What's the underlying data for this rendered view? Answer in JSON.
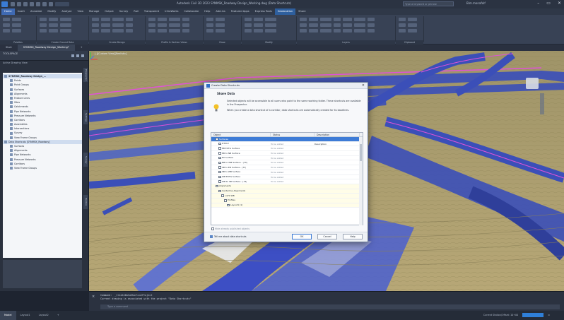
{
  "window": {
    "title": "Autodesk Civil 3D 2023  SYNMSK_Roadway Design_Working.dwg (Data Shortcuts)",
    "search_placeholder": "Type a keyword or phrase",
    "user": "Bim.monafolf",
    "controls": [
      "–",
      "▭",
      "✕"
    ]
  },
  "ribbon": {
    "tabs": [
      "Home",
      "Insert",
      "Annotate",
      "Modify",
      "Analyze",
      "View",
      "Manage",
      "Output",
      "Survey",
      "Rail",
      "Transparent",
      "InfraWorks",
      "Collaborate",
      "Help",
      "Add-ins",
      "Featured Apps",
      "Express Tools",
      "Geolocation",
      "Share"
    ],
    "active_tab": "Home",
    "panel_labels": [
      "Palettes",
      "Create Ground Data",
      "Create Design",
      "Profile & Section Views",
      "Draw",
      "Modify",
      "Layers",
      "Clipboard"
    ]
  },
  "file_tabs": [
    "Start",
    "SYNMSK_Roadway Design_Working*",
    "+"
  ],
  "toolspace": {
    "title": "TOOLSPACE",
    "subheader": "Active Drawing View",
    "tree": [
      {
        "label": "SYNMSK_Roadway Design_...",
        "bold": true,
        "sel": true,
        "indent": 0
      },
      {
        "label": "Points",
        "indent": 2
      },
      {
        "label": "Point Groups",
        "indent": 2
      },
      {
        "label": "Surfaces",
        "indent": 2
      },
      {
        "label": "Alignments",
        "indent": 2
      },
      {
        "label": "Feature Lines",
        "indent": 2
      },
      {
        "label": "Sites",
        "indent": 2
      },
      {
        "label": "Catchments",
        "indent": 2
      },
      {
        "label": "Pipe Networks",
        "indent": 2
      },
      {
        "label": "Pressure Networks",
        "indent": 2
      },
      {
        "label": "Corridors",
        "indent": 2
      },
      {
        "label": "Assemblies",
        "indent": 2
      },
      {
        "label": "Intersections",
        "indent": 2
      },
      {
        "label": "Survey",
        "indent": 2
      },
      {
        "label": "View Frame Groups",
        "indent": 2
      },
      {
        "label": "Data Shortcuts [SYNMSK_Roadway]",
        "indent": 0,
        "sel": true
      },
      {
        "label": "Surfaces",
        "indent": 2
      },
      {
        "label": "Alignments",
        "indent": 2
      },
      {
        "label": "Pipe Networks",
        "indent": 2
      },
      {
        "label": "Pressure Networks",
        "indent": 2
      },
      {
        "label": "Corridors",
        "indent": 2
      },
      {
        "label": "View Frame Groups",
        "indent": 2
      }
    ],
    "side_tabs": [
      "Prospector",
      "Settings",
      "Survey",
      "Toolbox"
    ]
  },
  "viewport": {
    "label": "[-][Custom View][Realistic]"
  },
  "dialog": {
    "title": "Create Data Shortcuts",
    "heading": "Share Data",
    "desc1": "Selected objects will be accessible to all users who point to the same working folder. These shortcuts are available in the Prospector.",
    "desc2": "When you create a data shortcut of a corridor, data shortcuts are automatically created for its baselines.",
    "columns": [
      "Object",
      "Status",
      "Description"
    ],
    "rows": [
      {
        "name": "Surfaces",
        "status": "",
        "desc": "",
        "indent": 1,
        "sel": true
      },
      {
        "name": "DTM-E",
        "status": "To be added",
        "desc": "Description",
        "indent": 2
      },
      {
        "name": "EB EXTG Surface",
        "status": "To be added",
        "desc": "",
        "indent": 2
      },
      {
        "name": "EB to NB Surface",
        "status": "To be added",
        "desc": "",
        "indent": 2
      },
      {
        "name": "EX Surface",
        "status": "To be added",
        "desc": "",
        "indent": 2
      },
      {
        "name": "NB to WB Surface - (70)",
        "status": "To be added",
        "desc": "",
        "indent": 2
      },
      {
        "name": "SB to EB Surface - (73)",
        "status": "To be added",
        "desc": "",
        "indent": 2
      },
      {
        "name": "SB to WB Surface",
        "status": "To be added",
        "desc": "",
        "indent": 2
      },
      {
        "name": "WB EXTG Surface",
        "status": "To be added",
        "desc": "",
        "indent": 2
      },
      {
        "name": "WB to SB Surface - (74)",
        "status": "To be added",
        "desc": "",
        "indent": 2
      },
      {
        "name": "Alignments",
        "status": "",
        "desc": "",
        "indent": 1,
        "band": true
      },
      {
        "name": "Centerline Alignments",
        "status": "",
        "desc": "",
        "indent": 2,
        "band": true
      },
      {
        "name": "I-470 WB",
        "status": "",
        "desc": "",
        "indent": 3,
        "band": true
      },
      {
        "name": "Profiles",
        "status": "",
        "desc": "",
        "indent": 4,
        "band": true
      },
      {
        "name": "Layout1 (1)",
        "status": "",
        "desc": "",
        "indent": 5,
        "band": true
      }
    ],
    "checkbox_label": "Hide already published objects",
    "help_link": "Tell me about data shortcuts",
    "buttons": {
      "ok": "OK",
      "cancel": "Cancel",
      "help": "Help"
    }
  },
  "command": {
    "history": [
      "Command:  _CreateDataShortcutProject",
      "Current drawing is associated with the project \"Data Shortcuts\""
    ],
    "placeholder": "Type a command"
  },
  "status_bar": {
    "layout_tabs": [
      "Model",
      "Layout1",
      "Layout2",
      "+"
    ],
    "active_layout": "Model",
    "right_text": "Current Station/Offset: 10+00"
  }
}
